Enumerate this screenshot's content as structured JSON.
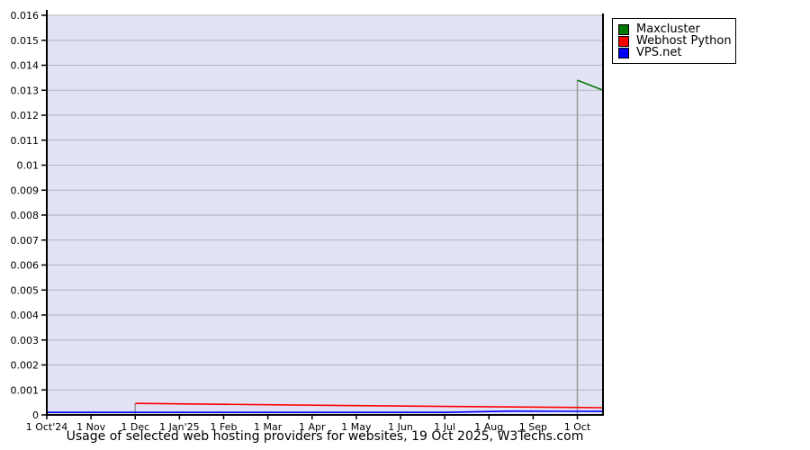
{
  "caption": "Usage of selected web hosting providers for websites, 19 Oct 2025, W3Techs.com",
  "legend": {
    "position": "top-right"
  },
  "chart_data": {
    "type": "line",
    "title": "Usage of selected web hosting providers for websites, 19 Oct 2025, W3Techs.com",
    "xlabel": "",
    "ylabel": "",
    "ylim": [
      0,
      0.016
    ],
    "x_domain_months": [
      0,
      12.58
    ],
    "grid": "horizontal",
    "legend_position": "top-right",
    "colors": {
      "plot_bg": "#e2e2f5",
      "grid": "#b3b3b8",
      "axis": "#000000",
      "drop_line": "#999999"
    },
    "y_ticks": [
      {
        "v": 0,
        "label": "0"
      },
      {
        "v": 0.001,
        "label": "0.001"
      },
      {
        "v": 0.002,
        "label": "0.002"
      },
      {
        "v": 0.003,
        "label": "0.003"
      },
      {
        "v": 0.004,
        "label": "0.004"
      },
      {
        "v": 0.005,
        "label": "0.005"
      },
      {
        "v": 0.006,
        "label": "0.006"
      },
      {
        "v": 0.007,
        "label": "0.007"
      },
      {
        "v": 0.008,
        "label": "0.008"
      },
      {
        "v": 0.009,
        "label": "0.009"
      },
      {
        "v": 0.01,
        "label": "0.01"
      },
      {
        "v": 0.011,
        "label": "0.011"
      },
      {
        "v": 0.012,
        "label": "0.012"
      },
      {
        "v": 0.013,
        "label": "0.013"
      },
      {
        "v": 0.014,
        "label": "0.014"
      },
      {
        "v": 0.015,
        "label": "0.015"
      },
      {
        "v": 0.016,
        "label": "0.016"
      }
    ],
    "x_ticks": [
      {
        "m": 0,
        "label": "1 Oct'24"
      },
      {
        "m": 1,
        "label": "1 Nov"
      },
      {
        "m": 2,
        "label": "1 Dec"
      },
      {
        "m": 3,
        "label": "1 Jan'25"
      },
      {
        "m": 4,
        "label": "1 Feb"
      },
      {
        "m": 5,
        "label": "1 Mar"
      },
      {
        "m": 6,
        "label": "1 Apr"
      },
      {
        "m": 7,
        "label": "1 May"
      },
      {
        "m": 8,
        "label": "1 Jun"
      },
      {
        "m": 9,
        "label": "1 Jul"
      },
      {
        "m": 10,
        "label": "1 Aug"
      },
      {
        "m": 11,
        "label": "1 Sep"
      },
      {
        "m": 12,
        "label": "1 Oct"
      }
    ],
    "series": [
      {
        "name": "Maxcluster",
        "color": "#007700",
        "drop_line_at_start": true,
        "points": [
          [
            12,
            0.0134
          ],
          [
            12.58,
            0.013
          ]
        ]
      },
      {
        "name": "Webhost Python",
        "color": "#ff0000",
        "drop_line_at_start": true,
        "points": [
          [
            2,
            0.00046
          ],
          [
            7,
            0.00037
          ],
          [
            12.58,
            0.00029
          ]
        ]
      },
      {
        "name": "VPS.net",
        "color": "#0000ff",
        "drop_line_at_start": false,
        "points": [
          [
            0,
            0.0001
          ],
          [
            9,
            0.0001
          ],
          [
            10.5,
            0.00015
          ],
          [
            12.58,
            0.00014
          ]
        ]
      }
    ]
  }
}
